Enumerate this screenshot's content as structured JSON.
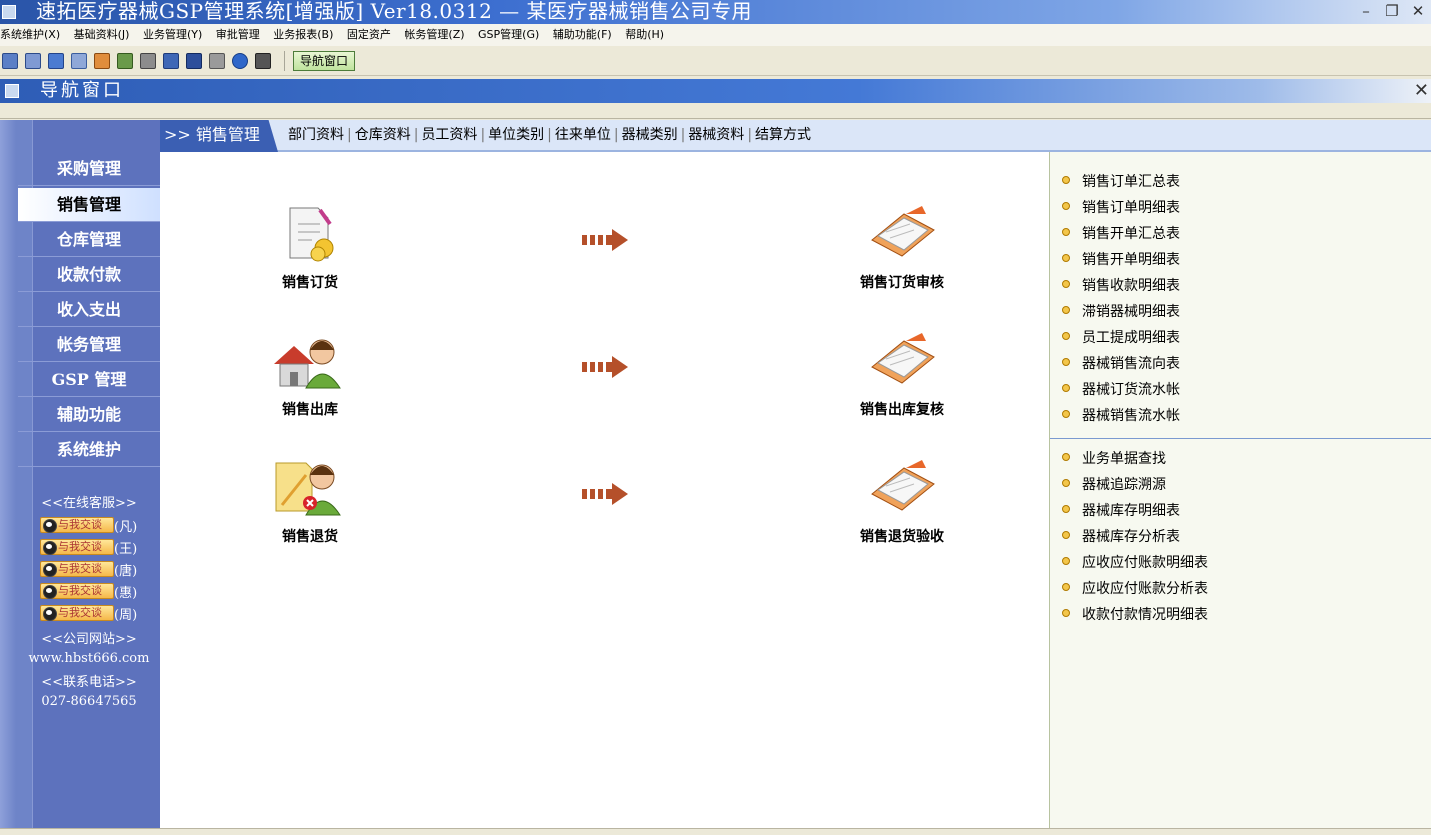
{
  "window": {
    "title": "速拓医疗器械GSP管理系统[增强版] Ver18.0312 — 某医疗器械销售公司专用",
    "buttons": [
      "–",
      "❐",
      "✕"
    ]
  },
  "menubar": [
    "系统维护(X)",
    "基础资料(J)",
    "业务管理(Y)",
    "审批管理",
    "业务报表(B)",
    "固定资产",
    "帐务管理(Z)",
    "GSP管理(G)",
    "辅助功能(F)",
    "帮助(H)"
  ],
  "toolbar": {
    "icons": [
      "table-icon",
      "list-icon",
      "window-icon",
      "chat-icon",
      "chat-icon",
      "tools-icon",
      "export-icon",
      "image-icon",
      "save-icon",
      "print-icon",
      "help-icon",
      "exit-icon"
    ],
    "nav_button": "导航窗口"
  },
  "child_window": {
    "title": "导航窗口",
    "close": "✕"
  },
  "sidebar": {
    "items": [
      "采购管理",
      "销售管理",
      "仓库管理",
      "收款付款",
      "收入支出",
      "帐务管理",
      "GSP 管理",
      "辅助功能",
      "系统维护"
    ],
    "active_index": 1,
    "service_title": "<<在线客服>>",
    "qq_button_text": "与我交谈",
    "qq_contacts": [
      "(凡)",
      "(王)",
      "(唐)",
      "(惠)",
      "(周)"
    ],
    "website_title": "<<公司网站>>",
    "website": "www.hbst666.com",
    "phone_title": "<<联系电话>>",
    "phone": "027-86647565"
  },
  "tabhead": {
    "current": ">> 销售管理",
    "links": [
      "部门资料",
      "仓库资料",
      "员工资料",
      "单位类别",
      "往来单位",
      "器械类别",
      "器械资料",
      "结算方式"
    ]
  },
  "flow": [
    {
      "left": "销售订货",
      "right": "销售订货审核"
    },
    {
      "left": "销售出库",
      "right": "销售出库复核"
    },
    {
      "left": "销售退货",
      "right": "销售退货验收"
    }
  ],
  "reports_top": [
    "销售订单汇总表",
    "销售订单明细表",
    "销售开单汇总表",
    "销售开单明细表",
    "销售收款明细表",
    "滞销器械明细表",
    "员工提成明细表",
    "器械销售流向表",
    "器械订货流水帐",
    "器械销售流水帐"
  ],
  "reports_bottom": [
    "业务单据查找",
    "器械追踪溯源",
    "器械库存明细表",
    "器械库存分析表",
    "应收应付账款明细表",
    "应收应付账款分析表",
    "收款付款情况明细表"
  ],
  "colors": {
    "sidebar": "#5d72bd",
    "title_blue": "#2a55a8",
    "tab_active": "#3b5fb3",
    "arrow": "#b5502a"
  }
}
